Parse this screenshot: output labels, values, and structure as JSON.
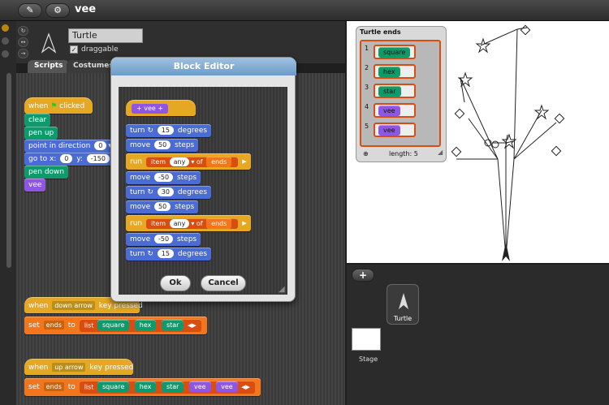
{
  "topbar": {
    "file_icon": "pencil-icon",
    "settings_icon": "gear-icon",
    "title": "vee"
  },
  "sprite": {
    "name": "Turtle",
    "draggable_label": "draggable",
    "draggable_checked": "✓"
  },
  "tabs": [
    {
      "label": "Scripts"
    },
    {
      "label": "Costumes"
    }
  ],
  "scripts": {
    "script1": [
      {
        "text": "when",
        "suffix": "clicked",
        "icon": "green-flag-icon"
      },
      {
        "text": "clear"
      },
      {
        "text": "pen up"
      },
      {
        "text": "point in direction",
        "value": "0"
      },
      {
        "text": "go to x:",
        "x": "0",
        "ylabel": "y:",
        "y": "-150"
      },
      {
        "text": "pen down"
      },
      {
        "text": "vee"
      }
    ],
    "script2": {
      "hat": "when",
      "key": "down arrow",
      "hat_suffix": "key pressed",
      "set": "set",
      "var": "ends",
      "to": "to",
      "list": "list",
      "items": [
        "square",
        "hex",
        "star"
      ]
    },
    "script3": {
      "hat": "when",
      "key": "up arrow",
      "hat_suffix": "key pressed",
      "set": "set",
      "var": "ends",
      "to": "to",
      "list": "list",
      "items": [
        "square",
        "hex",
        "star",
        "vee",
        "vee"
      ]
    }
  },
  "editor": {
    "title": "Block Editor",
    "proto": "+ vee +",
    "lines": [
      {
        "a": "turn",
        "b": "15",
        "c": "degrees"
      },
      {
        "a": "move",
        "b": "50",
        "c": "steps"
      },
      {
        "a": "run",
        "item": "item",
        "any": "any",
        "of": "of",
        "ends": "ends"
      },
      {
        "a": "move",
        "b": "-50",
        "c": "steps"
      },
      {
        "a": "turn",
        "b": "30",
        "c": "degrees"
      },
      {
        "a": "move",
        "b": "50",
        "c": "steps"
      },
      {
        "a": "run",
        "item": "item",
        "any": "any",
        "of": "of",
        "ends": "ends"
      },
      {
        "a": "move",
        "b": "-50",
        "c": "steps"
      },
      {
        "a": "turn",
        "b": "15",
        "c": "degrees"
      }
    ],
    "ok": "Ok",
    "cancel": "Cancel"
  },
  "watcher": {
    "title": "Turtle ends",
    "items": [
      {
        "n": "1",
        "label": "square",
        "color": "#0e9a6c"
      },
      {
        "n": "2",
        "label": "hex",
        "color": "#0e9a6c"
      },
      {
        "n": "3",
        "label": "star",
        "color": "#0e9a6c"
      },
      {
        "n": "4",
        "label": "vee",
        "color": "#8f56e3"
      },
      {
        "n": "5",
        "label": "vee",
        "color": "#8f56e3"
      }
    ],
    "length": "length: 5"
  },
  "corral": {
    "add": "+",
    "sprite_label": "Turtle",
    "stage_label": "Stage"
  }
}
